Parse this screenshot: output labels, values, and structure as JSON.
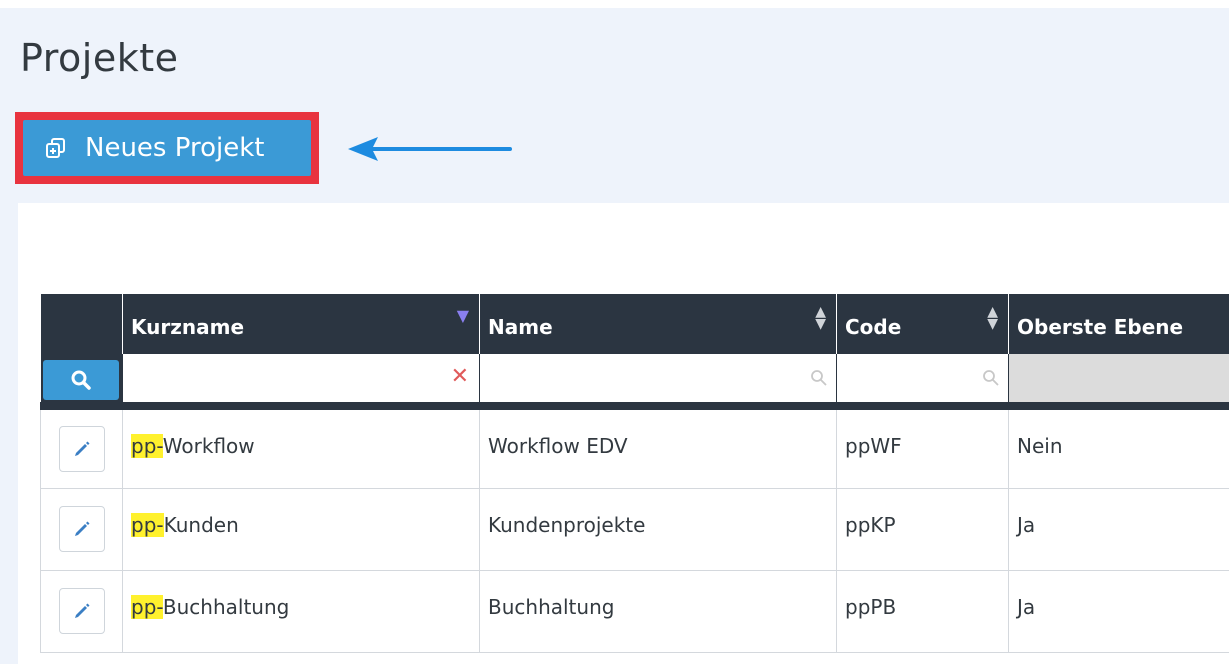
{
  "page": {
    "title": "Projekte",
    "new_button_label": "Neues Projekt"
  },
  "table": {
    "columns": [
      {
        "label": "",
        "sort": "none"
      },
      {
        "label": "Kurzname",
        "sort": "desc"
      },
      {
        "label": "Name",
        "sort": "both"
      },
      {
        "label": "Code",
        "sort": "both"
      },
      {
        "label": "Oberste Ebene",
        "sort": "none"
      }
    ],
    "filter": {
      "kurzname_value": "",
      "name_value": "",
      "code_value": ""
    },
    "rows": [
      {
        "prefix": "pp-",
        "kurzname_rest": "Workflow",
        "name": "Workflow EDV",
        "code": "ppWF",
        "oberste_ebene": "Nein"
      },
      {
        "prefix": "pp-",
        "kurzname_rest": "Kunden",
        "name": "Kundenprojekte",
        "code": "ppKP",
        "oberste_ebene": "Ja"
      },
      {
        "prefix": "pp-",
        "kurzname_rest": "Buchhaltung",
        "name": "Buchhaltung",
        "code": "ppPB",
        "oberste_ebene": "Ja"
      }
    ]
  },
  "colors": {
    "accent": "#3b9ad6",
    "header_bg": "#2b3541",
    "highlight_frame": "#e8333f",
    "search_highlight": "#fff12d"
  }
}
